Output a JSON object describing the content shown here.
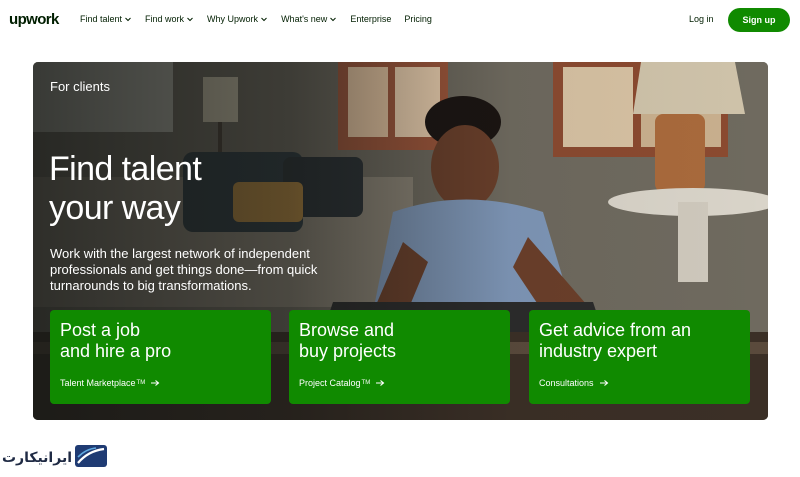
{
  "header": {
    "logo": "upwork",
    "nav": [
      {
        "label": "Find talent",
        "icon": "chevron-down-icon"
      },
      {
        "label": "Find work",
        "icon": "chevron-down-icon"
      },
      {
        "label": "Why Upwork",
        "icon": "chevron-down-icon"
      },
      {
        "label": "What's new",
        "icon": "chevron-down-icon"
      },
      {
        "label": "Enterprise"
      },
      {
        "label": "Pricing"
      }
    ],
    "login": "Log in",
    "signup": "Sign up"
  },
  "hero": {
    "eyebrow": "For clients",
    "headline_line1": "Find talent",
    "headline_line2": "your way",
    "subtext": "Work with the largest network of independent professionals and get things done—from quick turnarounds to big transformations.",
    "cards": [
      {
        "title_line1": "Post a job",
        "title_line2": "and hire a pro",
        "link": "Talent Marketplace",
        "tm": "TM",
        "icon": "arrow-right-icon"
      },
      {
        "title_line1": "Browse and",
        "title_line2": "buy projects",
        "link": "Project Catalog",
        "tm": "TM",
        "icon": "arrow-right-icon"
      },
      {
        "title_line1": "Get advice from an",
        "title_line2": "industry expert",
        "link": "Consultations",
        "tm": "",
        "icon": "arrow-right-icon"
      }
    ]
  },
  "watermark": {
    "text": "ایرانیکارت"
  },
  "colors": {
    "brand_green": "#108a00",
    "text_dark": "#001e00",
    "white": "#ffffff"
  }
}
